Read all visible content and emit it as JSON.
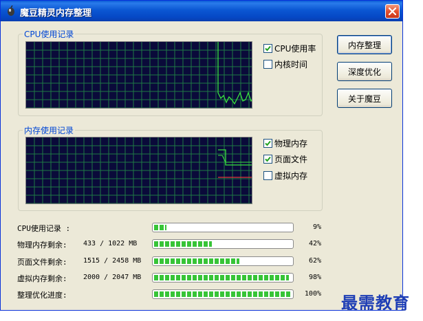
{
  "window": {
    "title": "魔豆精灵内存整理"
  },
  "cpu_group": {
    "legend": "CPU使用记录",
    "checks": [
      {
        "label": "CPU使用率",
        "checked": true
      },
      {
        "label": "内核时间",
        "checked": false
      }
    ]
  },
  "mem_group": {
    "legend": "内存使用记录",
    "checks": [
      {
        "label": "物理内存",
        "checked": true
      },
      {
        "label": "页面文件",
        "checked": true
      },
      {
        "label": "虚拟内存",
        "checked": false
      }
    ]
  },
  "buttons": {
    "optimize": "内存整理",
    "deep": "深度优化",
    "about": "关于魔豆"
  },
  "stats": [
    {
      "label": "CPU使用记录 :",
      "amount": "",
      "percent_text": "9%",
      "fraction": 0.09
    },
    {
      "label": "物理内存剩余:",
      "amount": "433 / 1022 MB",
      "percent_text": "42%",
      "fraction": 0.42
    },
    {
      "label": "页面文件剩余:",
      "amount": "1515 / 2458 MB",
      "percent_text": "62%",
      "fraction": 0.62
    },
    {
      "label": "虚拟内存剩余:",
      "amount": "2000 / 2047 MB",
      "percent_text": "98%",
      "fraction": 0.98
    },
    {
      "label": "整理优化进度:",
      "amount": "",
      "percent_text": "100%",
      "fraction": 1.0
    }
  ],
  "watermark": "最需教育",
  "colors": {
    "title_bar": "#0b57d3",
    "graph_bg": "#0a0a3a",
    "graph_grid": "#1f7a44",
    "cpu_line": "#39e23f",
    "phys_line": "#39e23f",
    "page_line": "#39e23f",
    "virt_line": "#e23a3a",
    "progress_fill": "#37c437"
  }
}
